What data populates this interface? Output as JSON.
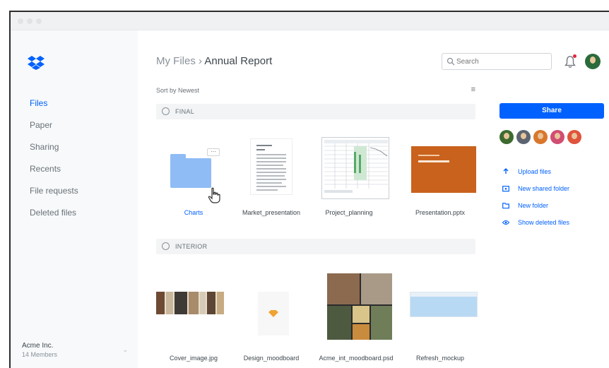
{
  "sidebar": {
    "items": [
      {
        "label": "Files",
        "active": true
      },
      {
        "label": "Paper",
        "active": false
      },
      {
        "label": "Sharing",
        "active": false
      },
      {
        "label": "Recents",
        "active": false
      },
      {
        "label": "File requests",
        "active": false
      },
      {
        "label": "Deleted files",
        "active": false
      }
    ],
    "team": {
      "name": "Acme Inc.",
      "members": "14 Members"
    }
  },
  "header": {
    "breadcrumb_parent": "My Files",
    "breadcrumb_separator": "›",
    "breadcrumb_current": "Annual Report",
    "search_placeholder": "Search"
  },
  "toolbar": {
    "sort_label": "Sort by Newest",
    "view_icon": "list-view-icon"
  },
  "sections": [
    {
      "label": "FINAL",
      "items": [
        {
          "name": "Charts",
          "type": "folder"
        },
        {
          "name": "Market_presentation",
          "type": "document"
        },
        {
          "name": "Project_planning",
          "type": "spreadsheet"
        },
        {
          "name": "Presentation.pptx",
          "type": "presentation"
        }
      ]
    },
    {
      "label": "INTERIOR",
      "items": [
        {
          "name": "Cover_image.jpg",
          "type": "image"
        },
        {
          "name": "Design_moodboard",
          "type": "sketch"
        },
        {
          "name": "Acme_int_moodboard.psd",
          "type": "moodboard"
        },
        {
          "name": "Refresh_mockup",
          "type": "mockup"
        }
      ]
    }
  ],
  "right_panel": {
    "share_label": "Share",
    "avatar_colors": [
      "#3d6b2f",
      "#5b6470",
      "#d9772c",
      "#d14d72",
      "#e0533c"
    ],
    "actions": [
      {
        "label": "Upload files",
        "icon": "upload-icon"
      },
      {
        "label": "New shared folder",
        "icon": "shared-folder-icon"
      },
      {
        "label": "New folder",
        "icon": "folder-icon"
      },
      {
        "label": "Show deleted files",
        "icon": "eye-icon"
      }
    ]
  },
  "colors": {
    "accent": "#0061fe",
    "folder": "#8fbcf5",
    "presentation": "#c9621d"
  }
}
